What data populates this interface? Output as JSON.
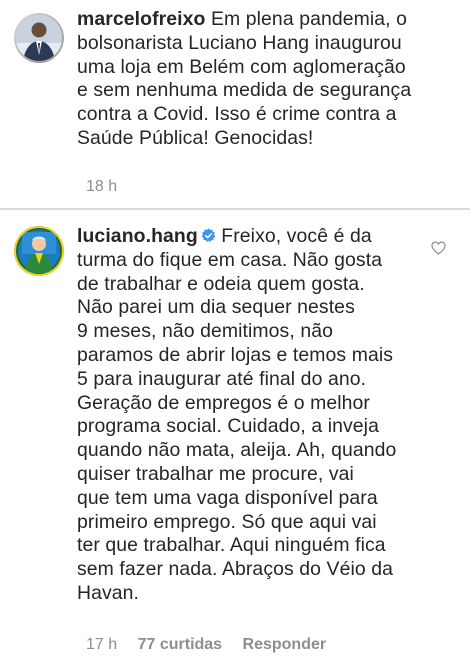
{
  "comments": [
    {
      "username": "marcelofreixo",
      "lines": [
        "Em plena pandemia, o",
        "bolsonarista Luciano Hang inaugurou",
        "uma loja em Belém com aglomeração",
        "e sem nenhuma medida de segurança",
        "contra a Covid. Isso é crime contra a",
        "Saúde Pública! Genocidas!"
      ],
      "time": "18 h",
      "avatar_icon": "user-avatar-icon"
    },
    {
      "username": "luciano.hang",
      "verified_icon": "verified-badge-icon",
      "lines": [
        "Freixo, você é da",
        "turma do fique em casa. Não gosta",
        "de trabalhar e odeia quem gosta.",
        "Não parei um dia sequer nestes",
        "9 meses, não demitimos, não",
        "paramos de abrir lojas e temos mais",
        "5 para inaugurar até final do ano.",
        "Geração de empregos é o melhor",
        "programa social. Cuidado, a inveja",
        "quando não mata, aleija. Ah, quando",
        "quiser trabalhar me procure, vai",
        "que tem uma vaga disponível para",
        "primeiro emprego. Só que aqui vai",
        "ter que trabalhar. Aqui ninguém fica",
        "sem fazer nada. Abraços do Véio da",
        "Havan."
      ],
      "time": "17 h",
      "likes": "77 curtidas",
      "reply": "Responder",
      "like_icon": "heart-icon",
      "avatar_icon": "user-avatar-icon"
    }
  ],
  "colors": {
    "text": "#262626",
    "meta": "#8e8e8e",
    "verified": "#3897f0",
    "divider": "#d9d9d9"
  }
}
